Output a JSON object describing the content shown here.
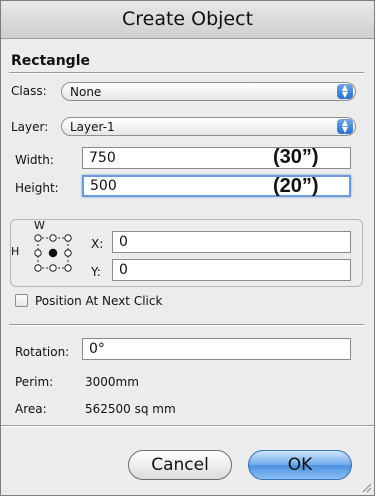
{
  "window": {
    "title": "Create Object"
  },
  "section": {
    "title": "Rectangle"
  },
  "class": {
    "label": "Class:",
    "value": "None"
  },
  "layer": {
    "label": "Layer:",
    "value": "Layer-1"
  },
  "width": {
    "label": "Width:",
    "value": "750",
    "annotation": "(30”)"
  },
  "height": {
    "label": "Height:",
    "value": "500",
    "annotation": "(20”)"
  },
  "position": {
    "w_label": "W",
    "h_label": "H",
    "x_label": "X:",
    "x_value": "0",
    "y_label": "Y:",
    "y_value": "0"
  },
  "option": {
    "label": "Position At Next Click",
    "checked": false
  },
  "rotation": {
    "label": "Rotation:",
    "value": "0°"
  },
  "perim": {
    "label": "Perim:",
    "value": "3000mm"
  },
  "area": {
    "label": "Area:",
    "value": "562500 sq mm"
  },
  "buttons": {
    "cancel": "Cancel",
    "ok": "OK"
  },
  "colors": {
    "focus_ring": "#6a9bd8",
    "ok_button": "#4c8fe0",
    "popup_arrow": "#2a6fcf"
  },
  "icons": {
    "popup_arrows": "up-down-arrows-icon",
    "anchor": "anchor-grid-icon",
    "resize": "resize-grip-icon"
  }
}
